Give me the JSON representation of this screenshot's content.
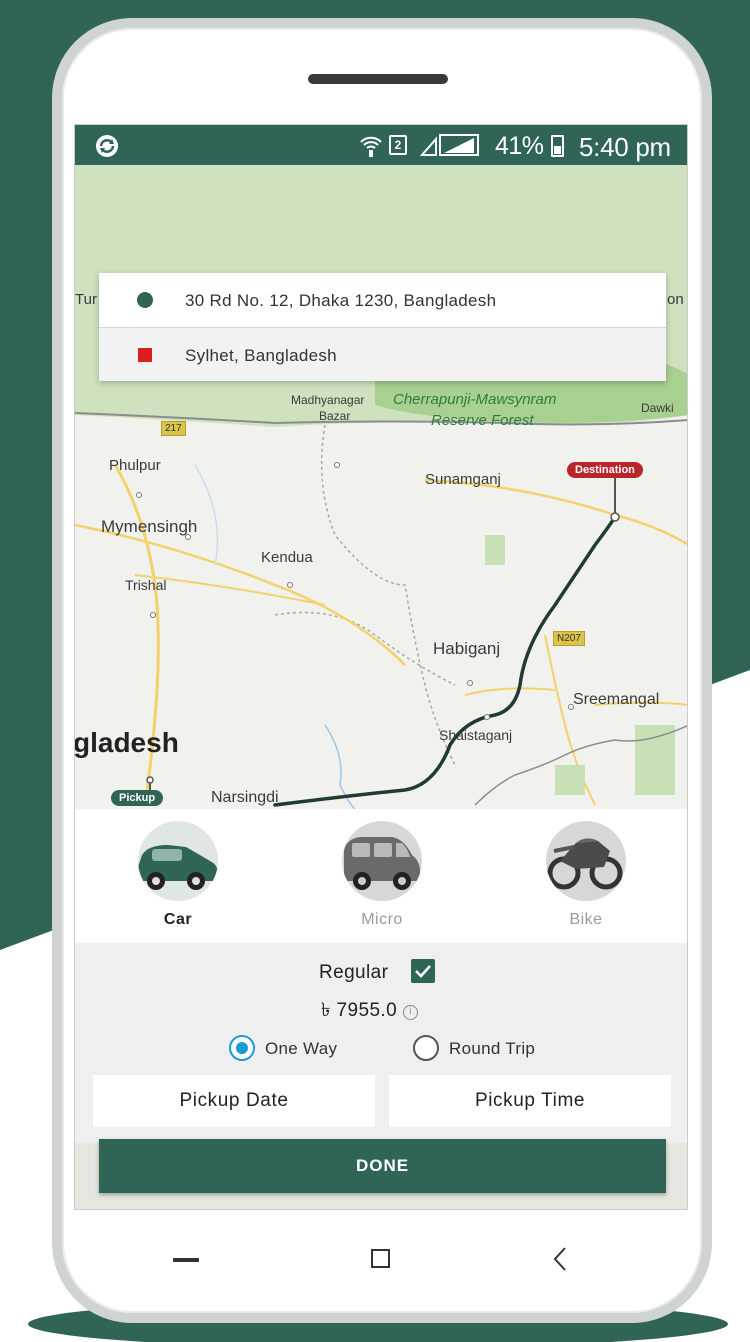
{
  "colors": {
    "brand": "#2f6457",
    "destination": "#b8262a",
    "origin_marker": "#2f6457",
    "destination_marker": "#d8201e",
    "radio_selected": "#1a9bd7",
    "route": "#1f3b33"
  },
  "status_bar": {
    "app_icon": "sync-icon",
    "sim_label": "2",
    "battery": "41%",
    "time": "5:40 pm"
  },
  "addresses": {
    "origin": "30 Rd No. 12, Dhaka 1230, Bangladesh",
    "destination": "Sylhet, Bangladesh"
  },
  "map": {
    "labels": {
      "phulpur": "Phulpur",
      "mymensingh": "Mymensingh",
      "trishal": "Trishal",
      "kendua": "Kendua",
      "sunamganj": "Sunamganj",
      "habiganj": "Habiganj",
      "sreemangal": "Sreemangal",
      "shaistaganj": "Shaistaganj",
      "narsingdi": "Narsingdi",
      "country": "gladesh",
      "madhyanagar": "Madhyanagar",
      "bazar": "Bazar",
      "cherrapunji_1": "Cherrapunji-Mawsynram",
      "cherrapunji_2": "Reserve Forest",
      "dawki": "Dawki",
      "tur": "Tur",
      "on": "on"
    },
    "road_shields": {
      "r217": "217",
      "n207": "N207"
    },
    "pins": {
      "destination": "Destination",
      "pickup": "Pickup"
    }
  },
  "vehicles": [
    {
      "label": "Car",
      "icon": "car-icon",
      "selected": true
    },
    {
      "label": "Micro",
      "icon": "minivan-icon",
      "selected": false
    },
    {
      "label": "Bike",
      "icon": "motorbike-icon",
      "selected": false
    }
  ],
  "fare": {
    "option_label": "Regular",
    "option_checked": true,
    "amount": "৳ 7955.0"
  },
  "trip_type": {
    "one_way": "One Way",
    "round_trip": "Round Trip",
    "selected": "one_way"
  },
  "pickup": {
    "date_label": "Pickup Date",
    "time_label": "Pickup Time"
  },
  "done_label": "DONE"
}
